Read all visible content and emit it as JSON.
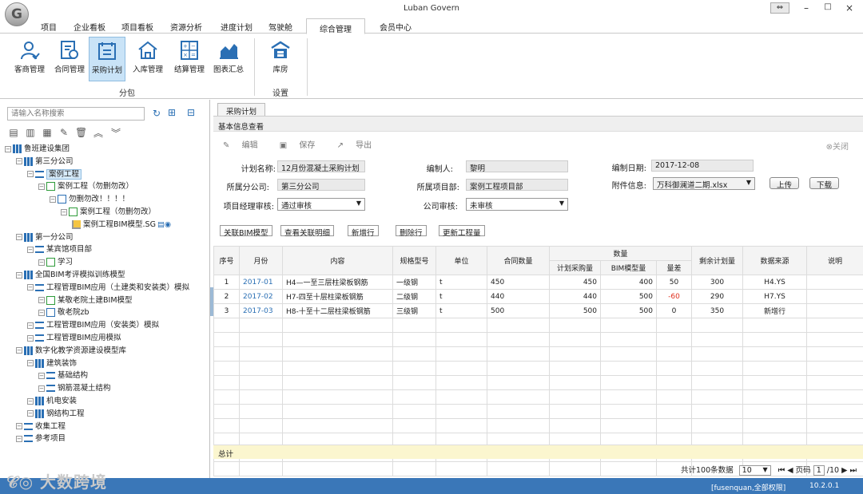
{
  "app": {
    "title": "Luban Govern",
    "logo_letter": "G",
    "window_controls": [
      "⇔",
      "–",
      "□",
      "×"
    ]
  },
  "menu": [
    "项目",
    "企业看板",
    "项目看板",
    "资源分析",
    "进度计划",
    "驾驶舱",
    "综合管理",
    "会员中心"
  ],
  "menu_active_index": 6,
  "ribbon": {
    "buttons": [
      {
        "label": "客商管理",
        "icon": "person-icon"
      },
      {
        "label": "合同管理",
        "icon": "contract-icon"
      },
      {
        "label": "采购计划",
        "icon": "purchase-plan-icon",
        "selected": true
      },
      {
        "label": "入库管理",
        "icon": "warehouse-in-icon"
      },
      {
        "label": "结算管理",
        "icon": "calculator-icon"
      },
      {
        "label": "图表汇总",
        "icon": "chart-summary-icon"
      },
      {
        "label": "库房",
        "icon": "storehouse-icon"
      }
    ],
    "groups": [
      "分包",
      "设置"
    ]
  },
  "left": {
    "search_placeholder": "请输入名称搜索",
    "tree": [
      {
        "label": "鲁班建设集团",
        "level": 0,
        "icon": "bar"
      },
      {
        "label": "第三分公司",
        "level": 1,
        "icon": "bar"
      },
      {
        "label": "案例工程",
        "level": 2,
        "icon": "list",
        "selected": true
      },
      {
        "label": "案例工程（勿删勿改）",
        "level": 3,
        "icon": "model"
      },
      {
        "label": "勿删勿改！！！！",
        "level": 4,
        "icon": "model-blue"
      },
      {
        "label": "案例工程（勿删勿改）",
        "level": 5,
        "icon": "model"
      },
      {
        "label": "案例工程BIM模型.SG",
        "level": 6,
        "icon": "folder",
        "tail": "▤◉"
      },
      {
        "label": "第一分公司",
        "level": 1,
        "icon": "bar"
      },
      {
        "label": "某宾馆项目部",
        "level": 2,
        "icon": "list"
      },
      {
        "label": "学习",
        "level": 3,
        "icon": "model"
      },
      {
        "label": "全国BIM考评模拟训练模型",
        "level": 1,
        "icon": "bar"
      },
      {
        "label": "工程管理BIM应用（土建类和安装类）模拟",
        "level": 2,
        "icon": "list"
      },
      {
        "label": "某敬老院土建BIM模型",
        "level": 3,
        "icon": "model"
      },
      {
        "label": "敬老院zb",
        "level": 3,
        "icon": "model-blue"
      },
      {
        "label": "工程管理BIM应用（安装类）模拟",
        "level": 2,
        "icon": "list"
      },
      {
        "label": "工程管理BIM应用模拟",
        "level": 2,
        "icon": "list"
      },
      {
        "label": "数字化教学资源建设模型库",
        "level": 1,
        "icon": "bar"
      },
      {
        "label": "建筑装饰",
        "level": 2,
        "icon": "bar"
      },
      {
        "label": "基础结构",
        "level": 3,
        "icon": "list"
      },
      {
        "label": "钢筋混凝土结构",
        "level": 3,
        "icon": "list"
      },
      {
        "label": "机电安装",
        "level": 2,
        "icon": "bar"
      },
      {
        "label": "钢结构工程",
        "level": 2,
        "icon": "bar"
      },
      {
        "label": "收集工程",
        "level": 1,
        "icon": "list"
      },
      {
        "label": "参考项目",
        "level": 1,
        "icon": "list"
      }
    ]
  },
  "main": {
    "tab": "采购计划",
    "section_title": "基本信息查看",
    "toolbar": {
      "edit": "编辑",
      "save": "保存",
      "export": "导出",
      "close": "关闭"
    },
    "form": {
      "plan_name_label": "计划名称:",
      "plan_name": "12月份混凝土采购计划",
      "author_label": "编制人:",
      "author": "黎明",
      "date_label": "编制日期:",
      "date": "2017-12-08",
      "branch_label": "所属分公司:",
      "branch": "第三分公司",
      "dept_label": "所属项目部:",
      "dept": "案例工程项目部",
      "attach_label": "附件信息:",
      "attach": "万科御澜道二期.xlsx",
      "upload": "上传",
      "download": "下载",
      "pm_review_label": "项目经理审核:",
      "pm_review": "通过审核",
      "company_review_label": "公司审核:",
      "company_review": "未审核"
    },
    "actions": [
      "关联BIM模型",
      "查看关联明细",
      "新增行",
      "删除行",
      "更新工程量"
    ],
    "table": {
      "headers": {
        "seq": "序号",
        "month": "月份",
        "content": "内容",
        "spec": "规格型号",
        "unit": "单位",
        "contract_qty": "合同数量",
        "qty": "数量",
        "plan_qty": "计划采购量",
        "bim_qty": "BIM模型量",
        "diff": "量差",
        "remain": "剩余计划量",
        "source": "数据来源",
        "note": "说明"
      },
      "rows": [
        {
          "seq": "1",
          "month": "2017-01",
          "content": "H4—一至三层柱梁板钢筋",
          "spec": "一级钢",
          "unit": "t",
          "contract_qty": "450",
          "plan_qty": "450",
          "bim_qty": "400",
          "diff": "50",
          "remain": "300",
          "source": "H4.YS",
          "note": ""
        },
        {
          "seq": "2",
          "month": "2017-02",
          "content": "H7-四至十层柱梁板钢筋",
          "spec": "二级钢",
          "unit": "t",
          "contract_qty": "440",
          "plan_qty": "440",
          "bim_qty": "500",
          "diff": "-60",
          "remain": "290",
          "source": "H7.YS",
          "note": ""
        },
        {
          "seq": "3",
          "month": "2017-03",
          "content": "H8-十至十二层柱梁板钢筋",
          "spec": "三级钢",
          "unit": "t",
          "contract_qty": "500",
          "plan_qty": "500",
          "bim_qty": "500",
          "diff": "0",
          "remain": "350",
          "source": "新增行",
          "note": ""
        }
      ],
      "empty_rows": 11
    },
    "total_label": "总计",
    "pager": {
      "summary": "共计100条数据",
      "page_size": "10",
      "page_label": "页码",
      "page": "1",
      "total_pages": "/10"
    }
  },
  "status": {
    "user": "[fusenquan,全部权限]",
    "version": "10.2.0.1"
  },
  "watermark": "大数跨境",
  "colors": {
    "accent": "#3a77b8",
    "selected": "#c9e3f7",
    "negative": "#e0301e",
    "link": "#2a6fb4"
  }
}
